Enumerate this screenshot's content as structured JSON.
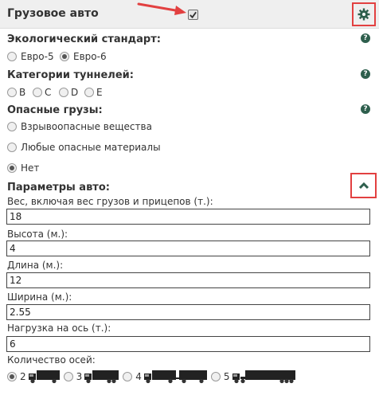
{
  "header": {
    "title": "Грузовое авто",
    "truck_enabled": true,
    "settings_icon": "gear-icon",
    "colors": {
      "icon": "#2e5f4d",
      "highlight": "#e24040"
    }
  },
  "eco": {
    "title": "Экологический стандарт:",
    "options": [
      {
        "label": "Евро-5",
        "checked": false
      },
      {
        "label": "Евро-6",
        "checked": true
      }
    ]
  },
  "tunnels": {
    "title": "Категории туннелей:",
    "options": [
      {
        "label": "B",
        "checked": false
      },
      {
        "label": "C",
        "checked": false
      },
      {
        "label": "D",
        "checked": false
      },
      {
        "label": "E",
        "checked": false
      }
    ]
  },
  "hazard": {
    "title": "Опасные грузы:",
    "options": [
      {
        "label": "Взрывоопасные вещества",
        "checked": false
      },
      {
        "label": "Любые опасные материалы",
        "checked": false
      },
      {
        "label": "Нет",
        "checked": true
      }
    ]
  },
  "params": {
    "title": "Параметры авто:",
    "fields": [
      {
        "label": "Вес, включая вес грузов и прицепов (т.):",
        "value": "18"
      },
      {
        "label": "Высота (м.):",
        "value": "4"
      },
      {
        "label": "Длина (м.):",
        "value": "12"
      },
      {
        "label": "Ширина (м.):",
        "value": "2.55"
      },
      {
        "label": "Нагрузка на ось (т.):",
        "value": "6"
      }
    ],
    "axles": {
      "label": "Количество осей:",
      "options": [
        {
          "label": "2",
          "checked": true
        },
        {
          "label": "3",
          "checked": false
        },
        {
          "label": "4",
          "checked": false
        },
        {
          "label": "5",
          "checked": false
        }
      ]
    }
  }
}
